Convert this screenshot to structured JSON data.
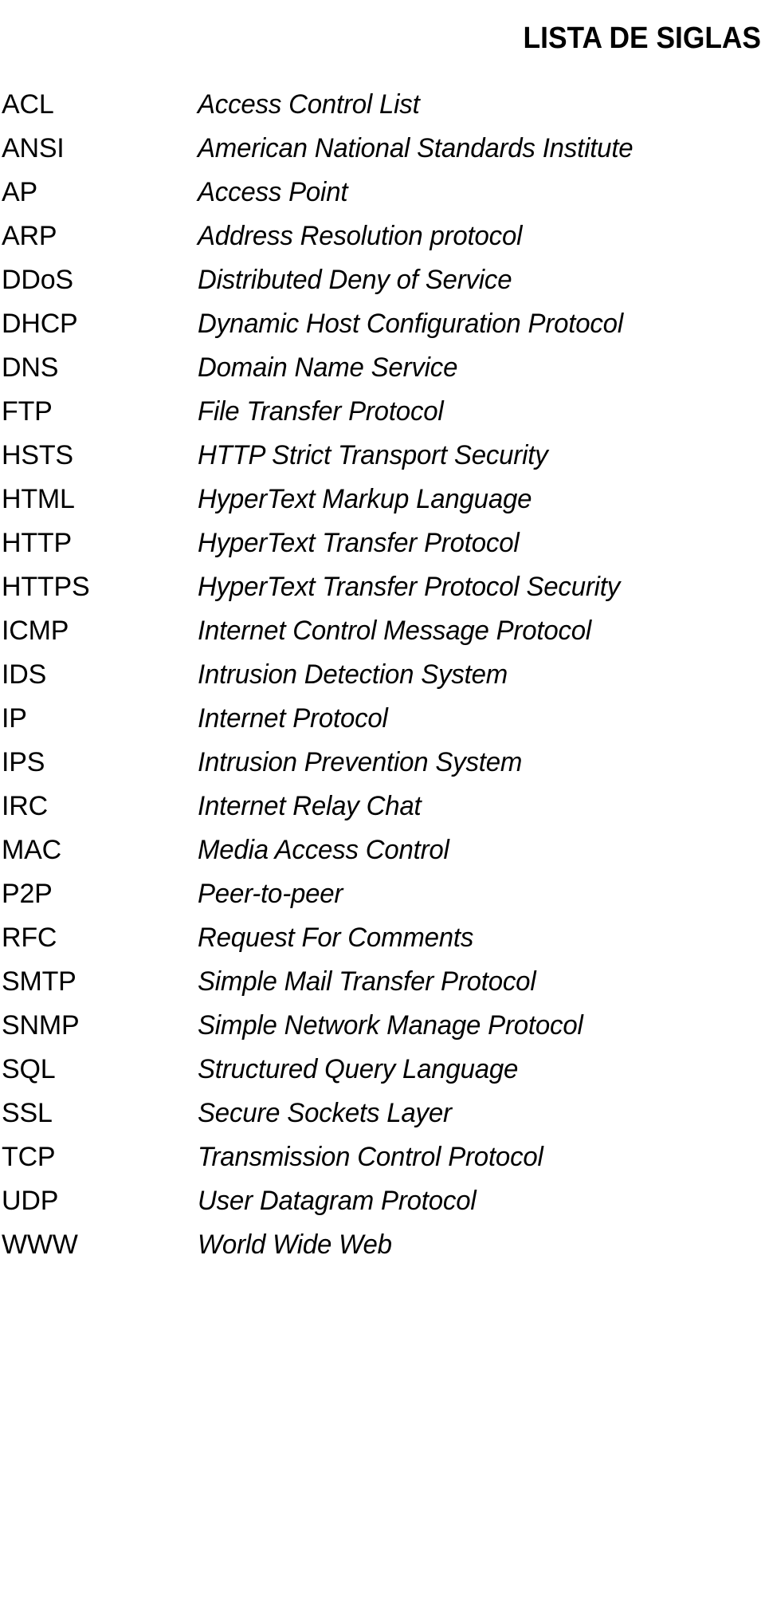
{
  "document": {
    "title": "LISTA DE SIGLAS"
  },
  "acronyms": [
    {
      "term": "ACL",
      "definition": "Access Control List"
    },
    {
      "term": "ANSI",
      "definition": "American National Standards Institute"
    },
    {
      "term": "AP",
      "definition": "Access Point"
    },
    {
      "term": "ARP",
      "definition": "Address Resolution protocol"
    },
    {
      "term": "DDoS",
      "definition": "Distributed Deny of Service"
    },
    {
      "term": "DHCP",
      "definition": "Dynamic Host Configuration Protocol"
    },
    {
      "term": "DNS",
      "definition": "Domain Name Service"
    },
    {
      "term": "FTP",
      "definition": "File Transfer Protocol"
    },
    {
      "term": "HSTS",
      "definition": "HTTP Strict Transport Security"
    },
    {
      "term": "HTML",
      "definition": "HyperText Markup Language"
    },
    {
      "term": "HTTP",
      "definition": "HyperText Transfer Protocol"
    },
    {
      "term": "HTTPS",
      "definition": "HyperText Transfer Protocol Security"
    },
    {
      "term": "ICMP",
      "definition": "Internet Control Message Protocol"
    },
    {
      "term": "IDS",
      "definition": "Intrusion Detection System"
    },
    {
      "term": "IP",
      "definition": "Internet Protocol"
    },
    {
      "term": "IPS",
      "definition": "Intrusion Prevention System"
    },
    {
      "term": "IRC",
      "definition": "Internet Relay Chat"
    },
    {
      "term": "MAC",
      "definition": "Media Access Control"
    },
    {
      "term": "P2P",
      "definition": "Peer-to-peer"
    },
    {
      "term": "RFC",
      "definition": "Request For Comments"
    },
    {
      "term": "SMTP",
      "definition": "Simple Mail Transfer Protocol"
    },
    {
      "term": "SNMP",
      "definition": "Simple Network Manage Protocol"
    },
    {
      "term": "SQL",
      "definition": "Structured Query Language"
    },
    {
      "term": "SSL",
      "definition": "Secure Sockets Layer"
    },
    {
      "term": "TCP",
      "definition": "Transmission Control Protocol"
    },
    {
      "term": "UDP",
      "definition": "User Datagram Protocol"
    },
    {
      "term": "WWW",
      "definition": "World Wide Web"
    }
  ]
}
